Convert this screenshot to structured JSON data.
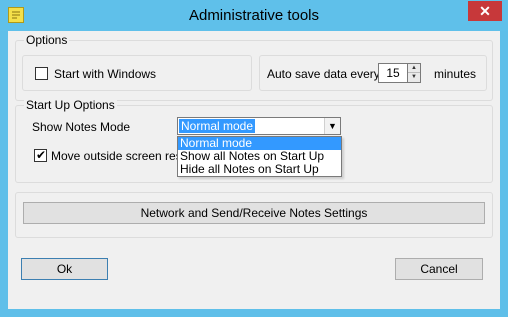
{
  "window": {
    "title": "Administrative tools",
    "close_glyph": "✕"
  },
  "options_group": {
    "legend": "Options",
    "start_with_windows": {
      "label": "Start with Windows",
      "checked": false
    },
    "auto_save": {
      "label_before": "Auto save data every",
      "value": "15",
      "label_after": "minutes"
    }
  },
  "startup_group": {
    "legend": "Start Up Options",
    "show_notes_mode": {
      "label": "Show Notes Mode",
      "selected": "Normal mode",
      "options": [
        "Normal mode",
        "Show all Notes on Start Up",
        "Hide all Notes on Start Up"
      ]
    },
    "move_outside": {
      "label": "Move outside screen resolu",
      "checked": true
    }
  },
  "network_button": {
    "label": "Network and Send/Receive Notes Settings"
  },
  "ok_button": {
    "label": "Ok"
  },
  "cancel_button": {
    "label": "Cancel"
  },
  "colors": {
    "title_bar": "#5fc0ea",
    "close_button": "#c7383a",
    "selection": "#3399ff"
  }
}
